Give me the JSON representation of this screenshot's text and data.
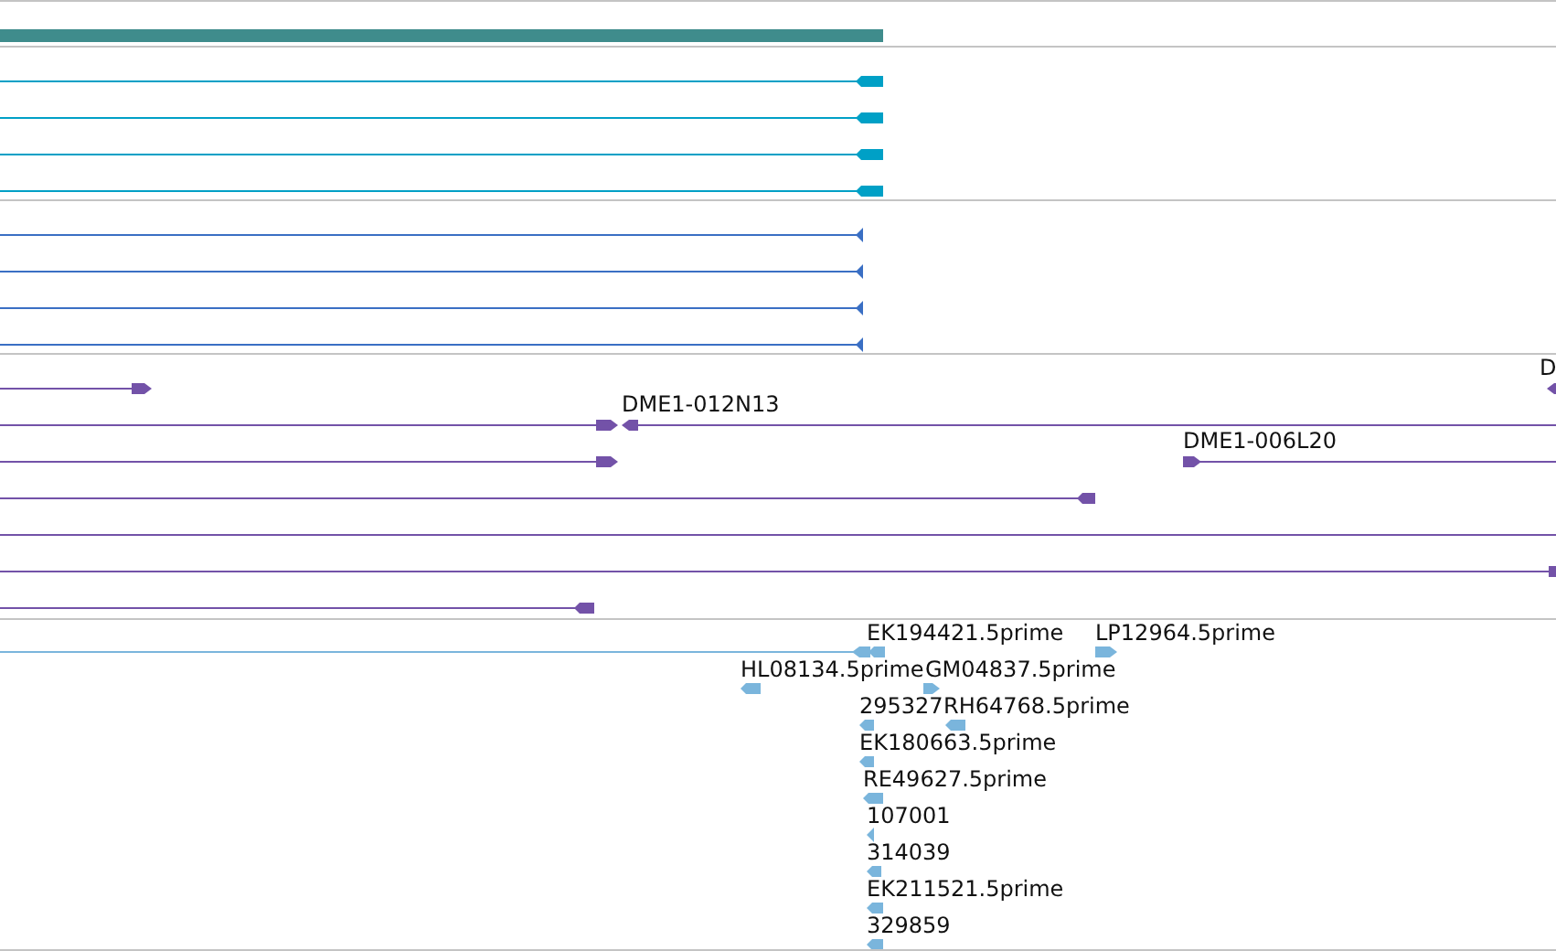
{
  "tracks": [
    {
      "kind": "gene_bar"
    },
    {
      "kind": "transcripts"
    },
    {
      "kind": "thin_transcripts"
    },
    {
      "kind": "clones",
      "labels": [
        "D",
        "DME1-012N13",
        "DME1-006L20"
      ]
    },
    {
      "kind": "ests",
      "labels": [
        "EK194421.5prime",
        "LP12964.5prime",
        "HL08134.5prime",
        "GM04837.5prime",
        "295327",
        "RH64768.5prime",
        "EK180663.5prime",
        "RE49627.5prime",
        "107001",
        "314039",
        "EK211521.5prime",
        "329859"
      ]
    }
  ]
}
